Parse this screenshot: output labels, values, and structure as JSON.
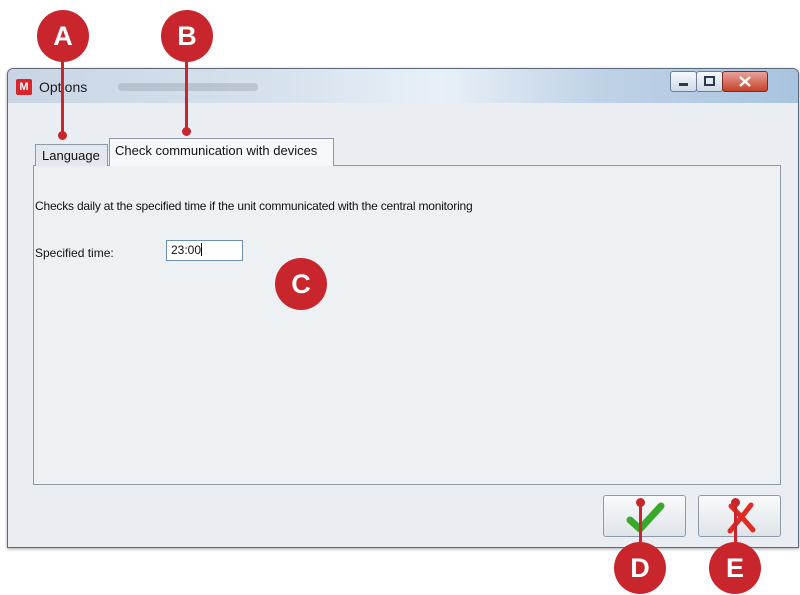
{
  "window": {
    "title": "Options",
    "app_icon": "M"
  },
  "tabs": [
    {
      "label": "Language"
    },
    {
      "label": "Check communication with devices"
    }
  ],
  "panel": {
    "description": "Checks daily at the specified time if the unit communicated with the central monitoring",
    "time_label": "Specified time:",
    "time_value": "23:00"
  },
  "buttons": {
    "ok_icon": "green-checkmark-icon",
    "cancel_icon": "red-x-icon"
  },
  "callouts": [
    "A",
    "B",
    "C",
    "D",
    "E"
  ],
  "colors": {
    "callout": "#c8262c",
    "ok": "#3aa82a",
    "cancel": "#e02a22"
  }
}
